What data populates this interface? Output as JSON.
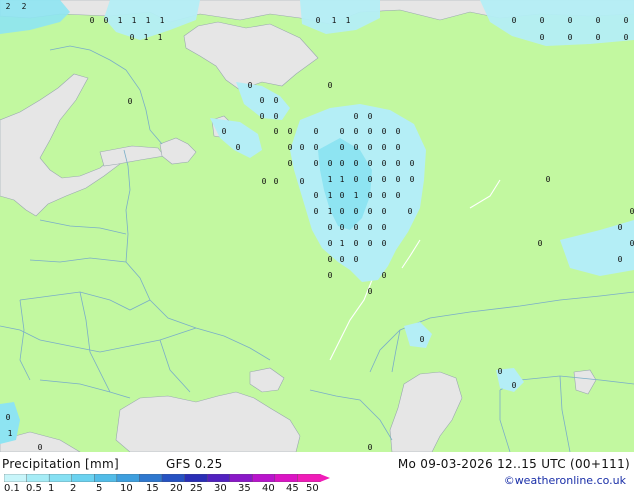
{
  "footer": {
    "title": "Precipitation [mm]",
    "model": "GFS 0.25",
    "valid_time": "Mo 09-03-2026 12..15 UTC (00+111)",
    "credit": "©weatheronline.co.uk"
  },
  "legend": {
    "ticks": [
      "0.1",
      "0.5",
      "1",
      "2",
      "5",
      "10",
      "15",
      "20",
      "25",
      "30",
      "35",
      "40",
      "45",
      "50"
    ],
    "colors": [
      "#c8f5fa",
      "#a6ecf6",
      "#86e0f3",
      "#6bd2f0",
      "#52bce8",
      "#3e9fde",
      "#2f78cf",
      "#2652c2",
      "#2a2eb6",
      "#5221c0",
      "#8a18c8",
      "#b914cc",
      "#db14c4",
      "#f01cb8"
    ]
  },
  "map": {
    "land_color": "#c2f8a0",
    "sea_color": "#e6e6e6",
    "border_color": "#7aaec8",
    "precip_light_color": "#b4eef6",
    "precip_mid_color": "#8ee4f2",
    "markers": [
      {
        "text": "0"
      },
      {
        "text": "1"
      },
      {
        "text": "2"
      }
    ]
  }
}
